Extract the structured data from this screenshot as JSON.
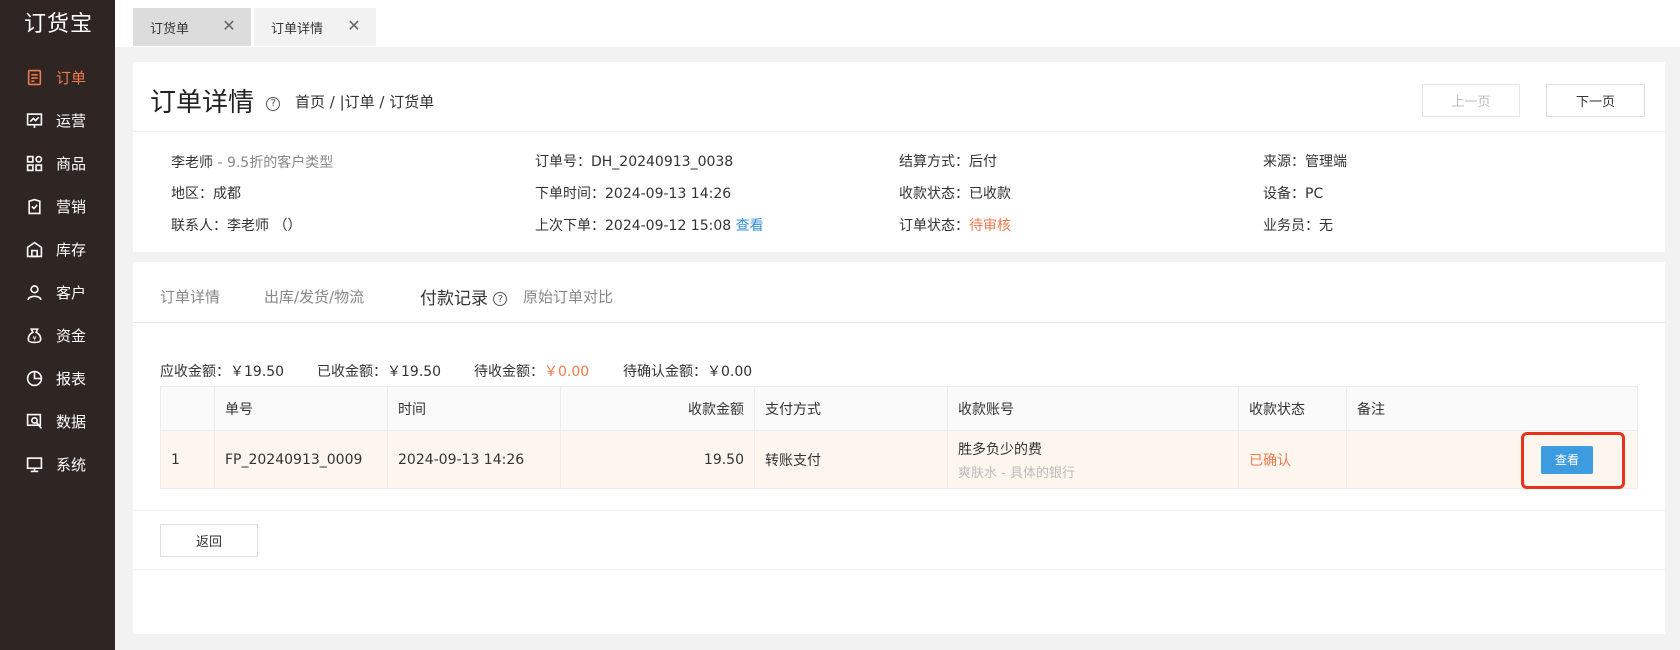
{
  "app": {
    "logo": "订货宝"
  },
  "sidebar": {
    "items": [
      {
        "label": "订单",
        "icon": "order-icon"
      },
      {
        "label": "运营",
        "icon": "operations-icon"
      },
      {
        "label": "商品",
        "icon": "products-icon"
      },
      {
        "label": "营销",
        "icon": "marketing-icon"
      },
      {
        "label": "库存",
        "icon": "inventory-icon"
      },
      {
        "label": "客户",
        "icon": "customer-icon"
      },
      {
        "label": "资金",
        "icon": "funds-icon"
      },
      {
        "label": "报表",
        "icon": "report-icon"
      },
      {
        "label": "数据",
        "icon": "data-icon"
      },
      {
        "label": "系统",
        "icon": "system-icon"
      }
    ],
    "active_color": "#ef7a4d"
  },
  "tabs": [
    {
      "label": "订货单"
    },
    {
      "label": "订单详情"
    }
  ],
  "header": {
    "title": "订单详情",
    "help": "?",
    "breadcrumb": "首页 / |订单 / 订货单",
    "prev_label": "上一页",
    "next_label": "下一页"
  },
  "info": {
    "customer_name": "李老师",
    "customer_type": " - 9.5折的客户类型",
    "region": "地区：成都",
    "contact": "联系人：李老师 （）",
    "order_no": "订单号：DH_20240913_0038",
    "order_time": "下单时间：2024-09-13 14:26",
    "last_order": "上次下单：2024-09-12 15:08",
    "last_order_link": "查看",
    "settlement": "结算方式：后付",
    "payment_status": "收款状态：已收款",
    "order_status_label": "订单状态：",
    "order_status_value": "待审核",
    "source": "来源：管理端",
    "device": "设备：PC",
    "salesperson": "业务员：无"
  },
  "detail_tabs": [
    {
      "label": "订单详情"
    },
    {
      "label": "出库/发货/物流"
    },
    {
      "label": "付款记录"
    },
    {
      "label": "原始订单对比"
    }
  ],
  "summary": {
    "receivable_label": "应收金额：",
    "receivable": "￥19.50",
    "received_label": "已收金额：",
    "received": "￥19.50",
    "pending_label": "待收金额：",
    "pending": "￥0.00",
    "unconfirmed_label": "待确认金额：",
    "unconfirmed": "￥0.00"
  },
  "table": {
    "headers": [
      "",
      "单号",
      "时间",
      "收款金额",
      "支付方式",
      "收款账号",
      "收款状态",
      "备注"
    ],
    "rows": [
      {
        "index": "1",
        "number": "FP_20240913_0009",
        "time": "2024-09-13 14:26",
        "amount": "19.50",
        "method": "转账支付",
        "account_main": "胜多负少的费",
        "account_sub": "爽肤水 - 具体的银行",
        "status": "已确认",
        "remark": "",
        "action": "查看"
      }
    ]
  },
  "back_label": "返回"
}
